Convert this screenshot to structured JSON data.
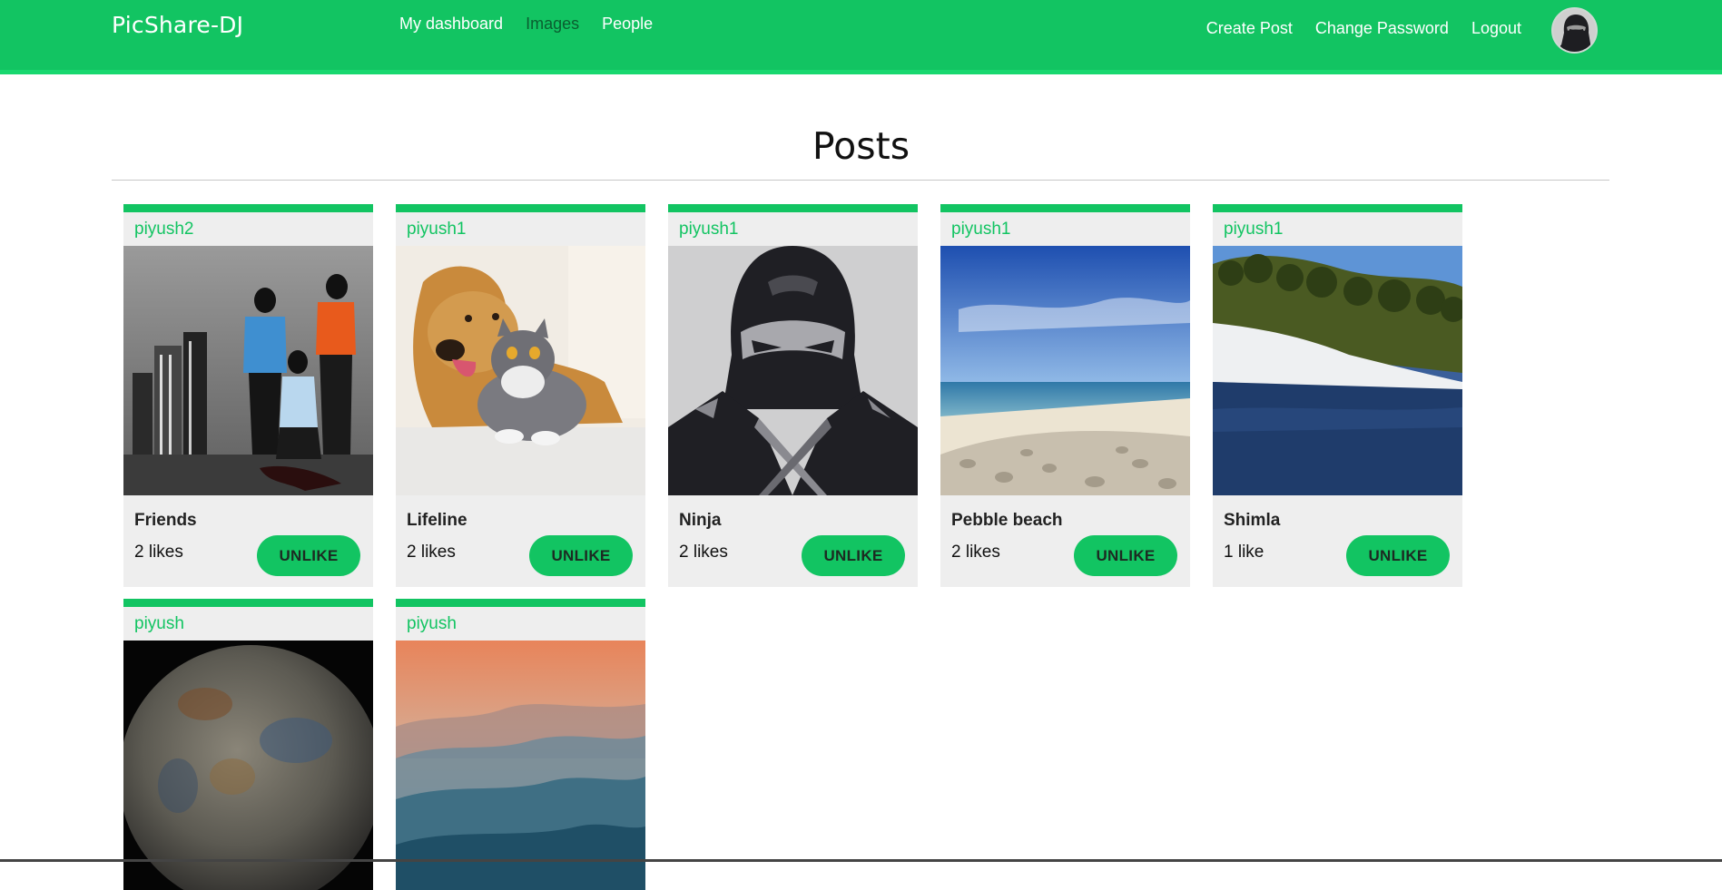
{
  "brand": "PicShare-DJ",
  "nav": {
    "left": [
      "My dashboard",
      "Images",
      "People"
    ],
    "active_index": 1,
    "right": [
      "Create Post",
      "Change Password",
      "Logout"
    ]
  },
  "page_title": "Posts",
  "colors": {
    "primary": "#12c462",
    "active_nav": "#0a5e30",
    "card_bg": "#eeeeee"
  },
  "unlike_label": "UNLIKE",
  "posts": [
    {
      "author": "piyush2",
      "title": "Friends",
      "likes": "2 likes",
      "image": "friends-silhouette-image"
    },
    {
      "author": "piyush1",
      "title": "Lifeline",
      "likes": "2 likes",
      "image": "dog-and-cat-image"
    },
    {
      "author": "piyush1",
      "title": "Ninja",
      "likes": "2 likes",
      "image": "ninja-logo-image"
    },
    {
      "author": "piyush1",
      "title": "Pebble beach",
      "likes": "2 likes",
      "image": "pebble-beach-image"
    },
    {
      "author": "piyush1",
      "title": "Shimla",
      "likes": "1 like",
      "image": "snowy-lake-image"
    },
    {
      "author": "piyush",
      "title": "",
      "likes": "",
      "image": "moon-image"
    },
    {
      "author": "piyush",
      "title": "",
      "likes": "",
      "image": "misty-mountains-image"
    }
  ]
}
